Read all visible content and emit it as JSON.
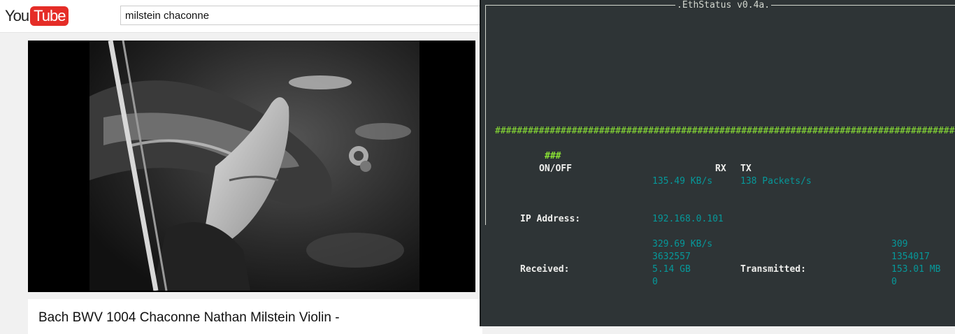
{
  "youtube": {
    "logo_you": "You",
    "logo_tube": "Tube",
    "search_value": "milstein chaconne",
    "video_title": "Bach BWV 1004 Chaconne Nathan Milstein Violin -"
  },
  "terminal": {
    "title": ".EthStatus v0.4a.",
    "hash_line": "###########################################################################################",
    "hash_small": "###",
    "on_off": "ON/OFF",
    "rx_label": "RX",
    "tx_label": "TX",
    "rx_speed": "135.49 KB/s",
    "tx_packets": "138 Packets/s",
    "ip_label": "IP Address:",
    "ip_value": "192.168.0.101",
    "received_label": "Received:",
    "transmitted_label": "Transmitted:",
    "rx_stats": [
      "329.69 KB/s",
      "3632557",
      "5.14 GB",
      "0"
    ],
    "tx_stats": [
      "309",
      "1354017",
      "153.01 MB",
      "0"
    ]
  }
}
